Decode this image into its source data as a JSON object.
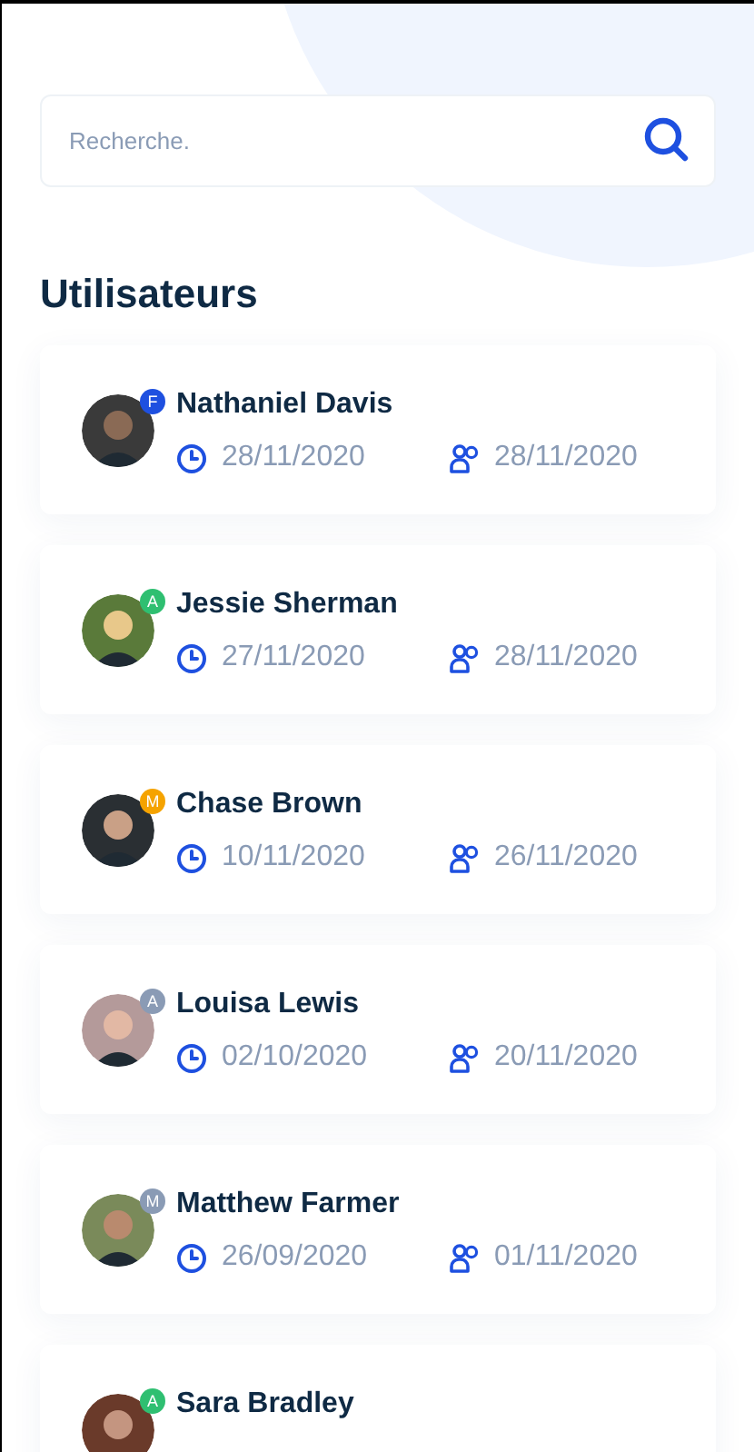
{
  "search": {
    "placeholder": "Recherche."
  },
  "title": "Utilisateurs",
  "users": [
    {
      "name": "Nathaniel Davis",
      "badge": "F",
      "color": "#1e50e0",
      "created": "28/11/2020",
      "joined": "28/11/2020"
    },
    {
      "name": "Jessie Sherman",
      "badge": "A",
      "color": "#2fbf71",
      "created": "27/11/2020",
      "joined": "28/11/2020"
    },
    {
      "name": "Chase Brown",
      "badge": "M",
      "color": "#f5a300",
      "created": "10/11/2020",
      "joined": "26/11/2020"
    },
    {
      "name": "Louisa Lewis",
      "badge": "A",
      "color": "#8a9bb5",
      "created": "02/10/2020",
      "joined": "20/11/2020"
    },
    {
      "name": "Matthew Farmer",
      "badge": "M",
      "color": "#8a9bb5",
      "created": "26/09/2020",
      "joined": "01/11/2020"
    },
    {
      "name": "Sara Bradley",
      "badge": "A",
      "color": "#2fbf71"
    }
  ]
}
